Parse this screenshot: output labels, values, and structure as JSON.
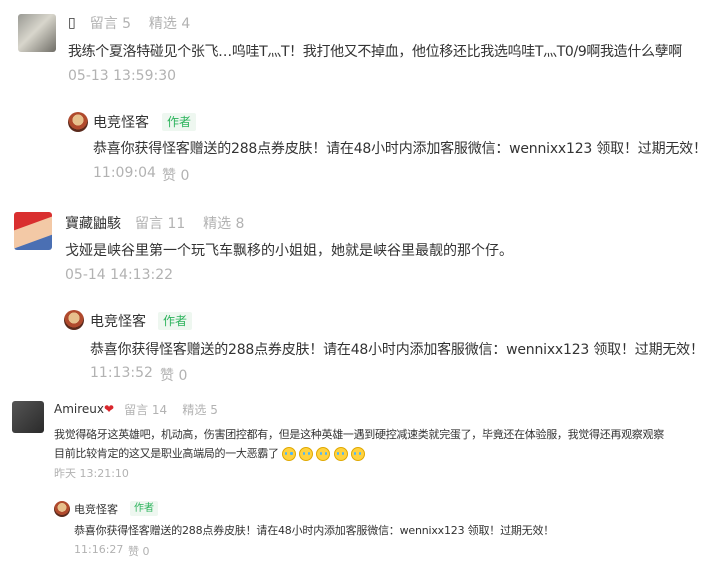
{
  "comments": [
    {
      "name": "▯",
      "stats": "留言 5    精选 4",
      "text": "我练个夏洛特碰见个张飞…呜哇T灬T！我打他又不掉血，他位移还比我选呜哇T灬T0/9啊我造什么孽啊",
      "time": "05-13 13:59:30",
      "reply": {
        "name": "电竞怪客",
        "tag": "作者",
        "text": "恭喜你获得怪客赠送的288点券皮肤！请在48小时内添加客服微信：wennixx123 领取！过期无效！",
        "time": "11:09:04",
        "likes": "赞 0"
      }
    },
    {
      "name": "寶藏鼬駭",
      "stats": "留言 11    精选 8",
      "text": "戈娅是峡谷里第一个玩飞车飘移的小姐姐，她就是峡谷里最靓的那个仔。",
      "time": "05-14 14:13:22",
      "reply": {
        "name": "电竞怪客",
        "tag": "作者",
        "text": "恭喜你获得怪客赠送的288点券皮肤！请在48小时内添加客服微信：wennixx123 领取！过期无效！",
        "time": "11:13:52",
        "likes": "赞 0"
      }
    },
    {
      "name": "Amireux",
      "heart": "❤",
      "stats": "留言 14    精选 5",
      "text_line1": "我觉得硌牙这英雄吧，机动高，伤害团控都有，但是这种英雄一遇到硬控减速类就完蛋了，毕竟还在体验服，我觉得还再观察观察",
      "text_line2": "目前比较肯定的这又是职业高端局的一大恶霸了",
      "time": "昨天 13:21:10",
      "reply": {
        "name": "电竞怪客",
        "tag": "作者",
        "text": "恭喜你获得怪客赠送的288点券皮肤！请在48小时内添加客服微信：wennixx123 领取！过期无效！",
        "time": "11:16:27",
        "likes": "赞 0"
      }
    }
  ]
}
